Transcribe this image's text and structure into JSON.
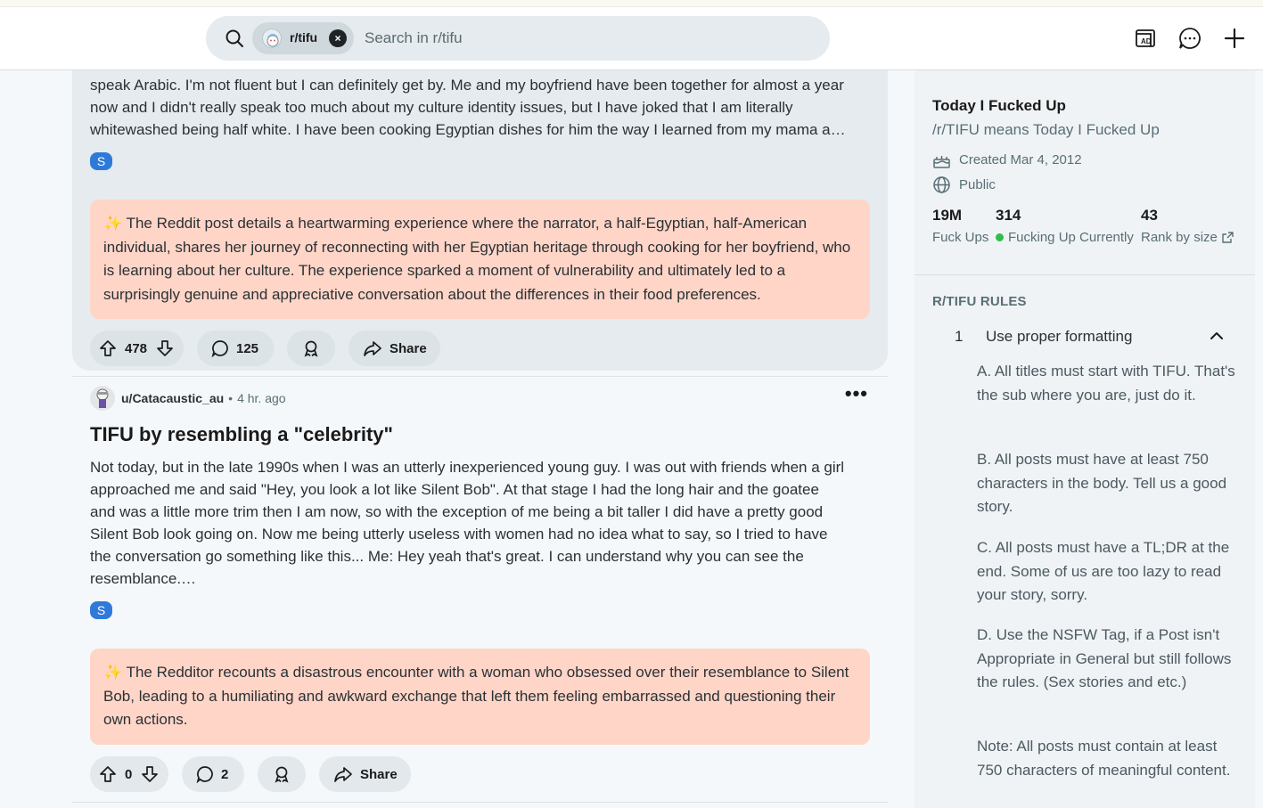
{
  "search": {
    "community_chip": "r/tifu",
    "clear_symbol": "×",
    "placeholder": "Search in r/tifu"
  },
  "header_actions": {
    "icons": [
      "advertise-icon",
      "chat-icon",
      "create-post-icon"
    ]
  },
  "posts": [
    {
      "excerpt_lines": [
        "speak Arabic. I'm not fluent but I can definitely get by. Me and my boyfriend have been together for almost a year",
        "now and I didn't really speak too much about my culture identity issues, but I have joked that I am literally",
        "whitewashed being half white. I have been cooking Egyptian dishes for him the way I learned from my mama a…"
      ],
      "badge": "S",
      "summary": "✨ The Reddit post details a heartwarming experience where the narrator, a half-Egyptian, half-American individual, shares her journey of reconnecting with her Egyptian heritage through cooking for her boyfriend, who is learning about her culture. The experience sparked a moment of vulnerability and ultimately led to a surprisingly genuine and appreciative conversation about the differences in their food preferences.",
      "votes": "478",
      "comments": "125",
      "share_label": "Share"
    },
    {
      "author": "u/Catacaustic_au",
      "separator": "•",
      "time": "4 hr. ago",
      "more": "•••",
      "title": "TIFU by resembling a \"celebrity\"",
      "excerpt_lines": [
        "Not today, but in the late 1990s when I was an utterly inexperienced young guy. I was out with friends when a girl",
        "approached me and said \"Hey, you look a lot like Silent Bob\". At that stage I had the long hair and the goatee",
        "and was a little more trim then I am now, so with the exception of me being a bit taller I did have a pretty good",
        "Silent Bob look going on. Now me being utterly useless with women had no idea what to say, so I tried to have",
        "the conversation go something like this... Me: Hey yeah that's great. I can understand why you can see the",
        "resemblance.…"
      ],
      "badge": "S",
      "summary": "✨ The Redditor recounts a disastrous encounter with a woman who obsessed over their resemblance to Silent Bob, leading to a humiliating and awkward exchange that left them feeling embarrassed and questioning their own actions.",
      "votes": "0",
      "comments": "2",
      "share_label": "Share"
    }
  ],
  "sidebar": {
    "title": "Today I Fucked Up",
    "subtitle": "/r/TIFU means Today I Fucked Up",
    "created": "Created Mar 4, 2012",
    "visibility": "Public",
    "stats": [
      {
        "value": "19M",
        "label": "Fuck Ups"
      },
      {
        "value": "314",
        "label": "Fucking Up Currently"
      },
      {
        "value": "43",
        "label": "Rank by size"
      }
    ],
    "rules_heading": "R/TIFU RULES",
    "rule_number": "1",
    "rule_title": "Use proper formatting",
    "rule_paragraphs": [
      "A. All titles must start with TIFU. That's the sub where you are, just do it.",
      "B. All posts must have at least 750 characters in the body. Tell us a good story.",
      "C. All posts must have a TL;DR at the end. Some of us are too lazy to read your story, sorry.",
      "D. Use the NSFW Tag, if a Post isn't Appropriate in General but still follows the rules. (Sex stories and etc.)",
      "Note: All posts must contain at least 750 characters of meaningful content."
    ]
  },
  "colors": {
    "summary_bg": "#ffd5c7",
    "badge_blue": "#2f7ad8",
    "online_green": "#2fbf49"
  }
}
